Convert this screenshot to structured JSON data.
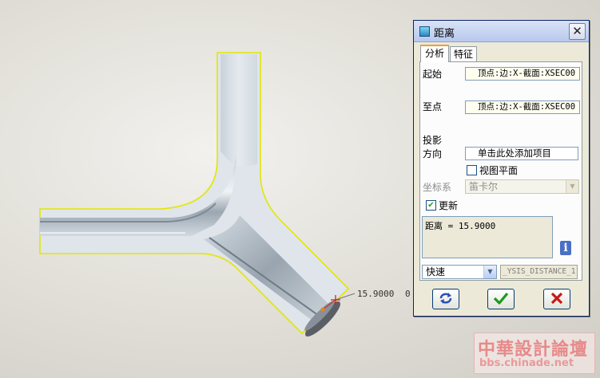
{
  "viewport": {
    "dimension_value": "15.9000",
    "dimension_suffix": "0"
  },
  "dialog": {
    "title": "距离",
    "close_glyph": "✕",
    "tabs": [
      {
        "label": "分析",
        "active": true
      },
      {
        "label": "特征",
        "active": false
      }
    ],
    "from_label": "起始",
    "from_value": "顶点:边:X-截面:XSEC00",
    "to_label": "至点",
    "to_value": "顶点:边:X-截面:XSEC00",
    "projection_label": "投影",
    "direction_label": "方向",
    "direction_value": "单击此处添加项目",
    "view_plane_label": "视图平面",
    "view_plane_checked": false,
    "coord_label": "坐标系",
    "coord_value": "笛卡尔",
    "update_label": "更新",
    "update_checked": true,
    "result_text": "距离 = 15.9000",
    "mode_value": "快速",
    "analysis_name": "_YSIS_DISTANCE_1",
    "buttons": {
      "repeat": "repeat-icon",
      "ok": "check-icon",
      "cancel": "x-icon"
    },
    "colors": {
      "ok_green": "#1a9a1a",
      "cancel_red": "#c81818",
      "repeat_blue": "#2850b8"
    }
  },
  "watermark": {
    "chinese": "中華設計論壇",
    "url": "bbs.chinade.net"
  }
}
